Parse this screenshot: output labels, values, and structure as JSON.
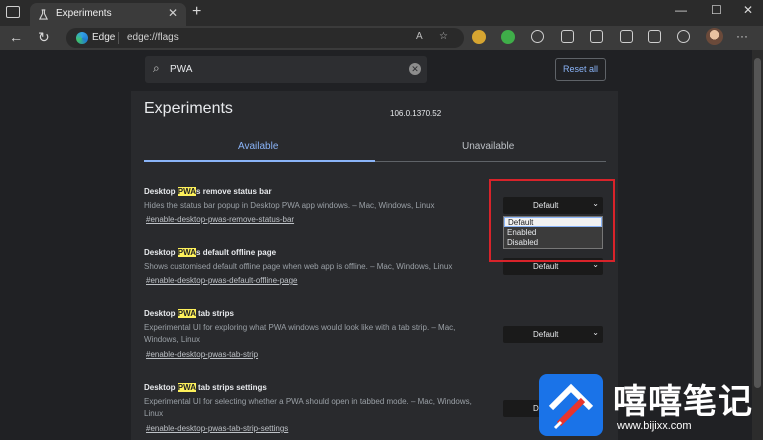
{
  "browser": {
    "tab_title": "Experiments",
    "tab_close": "✕",
    "new_tab": "+",
    "brand": "Edge",
    "url": "edge://flags",
    "window_controls": [
      "—",
      "☐",
      "✕"
    ],
    "more": "···"
  },
  "search": {
    "value": "PWA",
    "clear": "✕"
  },
  "reset_label": "Reset all",
  "page": {
    "heading": "Experiments",
    "version": "106.0.1370.52",
    "tabs": [
      "Available",
      "Unavailable"
    ]
  },
  "highlight_term": "PWA",
  "experiments": [
    {
      "title_pre": "Desktop ",
      "title_post": "s remove status bar",
      "description": "Hides the status bar popup in Desktop PWA app windows. – Mac, Windows, Linux",
      "link": "#enable-desktop-pwas-remove-status-bar",
      "value": "Default"
    },
    {
      "title_pre": "Desktop ",
      "title_post": "s default offline page",
      "description": "Shows customised default offline page when web app is offline. – Mac, Windows, Linux",
      "link": "#enable-desktop-pwas-default-offline-page",
      "value": "Default"
    },
    {
      "title_pre": "Desktop ",
      "title_post": " tab strips",
      "description": "Experimental UI for exploring what PWA windows would look like with a tab strip. – Mac, Windows, Linux",
      "link": "#enable-desktop-pwas-tab-strip",
      "value": "Default"
    },
    {
      "title_pre": "Desktop ",
      "title_post": " tab strips settings",
      "description": "Experimental UI for selecting whether a PWA should open in tabbed mode. – Mac, Windows, Linux",
      "link": "#enable-desktop-pwas-tab-strip-settings",
      "value": "De"
    }
  ],
  "dropdown_options": [
    "Default",
    "Enabled",
    "Disabled"
  ],
  "accent_colors": {
    "link_blue": "#8ab4f8",
    "highlight_yellow": "#fdf05b",
    "annotation_red": "#d8232a"
  },
  "watermark": {
    "brand": "嘻嘻笔记",
    "site": "www.bijixx.com"
  }
}
